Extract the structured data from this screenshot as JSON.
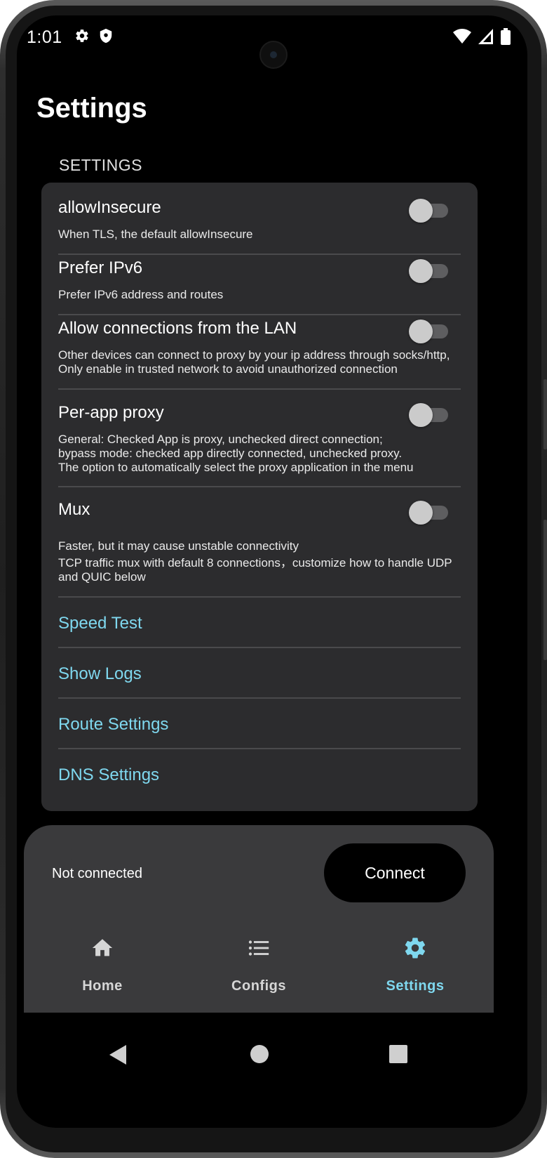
{
  "status_bar": {
    "time": "1:01",
    "left_icons": [
      "gear-icon",
      "shield-icon"
    ],
    "right_icons": [
      "wifi-icon",
      "signal-icon",
      "battery-icon"
    ]
  },
  "header": {
    "title": "Settings"
  },
  "section": {
    "label": "SETTINGS"
  },
  "settings": [
    {
      "title": "allowInsecure",
      "description": [
        "When TLS, the default allowInsecure"
      ],
      "enabled": false
    },
    {
      "title": "Prefer IPv6",
      "description": [
        "Prefer IPv6 address and routes"
      ],
      "enabled": false
    },
    {
      "title": "Allow connections from the LAN",
      "description": [
        "Other devices can connect to proxy by your ip address through socks/http,",
        "Only enable in trusted network to avoid unauthorized connection"
      ],
      "enabled": false
    },
    {
      "title": "Per-app proxy",
      "description": [
        "General: Checked App is proxy, unchecked direct connection;",
        "bypass mode: checked app directly connected, unchecked proxy.",
        "The option to automatically select the proxy application in the menu"
      ],
      "enabled": false
    },
    {
      "title": "Mux",
      "description": [
        "Faster, but it may cause unstable connectivity",
        "TCP traffic mux with default 8 connections，customize how to handle UDP",
        "and QUIC below"
      ],
      "enabled": false
    }
  ],
  "links": [
    "Speed Test",
    "Show Logs",
    "Route Settings",
    "DNS Settings"
  ],
  "connection": {
    "status": "Not connected",
    "button_label": "Connect"
  },
  "bottom_nav": [
    {
      "label": "Home",
      "icon": "home-icon",
      "active": false
    },
    {
      "label": "Configs",
      "icon": "list-icon",
      "active": false
    },
    {
      "label": "Settings",
      "icon": "gear-icon",
      "active": true
    }
  ],
  "colors": {
    "accent": "#7fd8ef",
    "card": "#2c2c2e",
    "panel": "#3a3a3c",
    "background": "#000000"
  }
}
